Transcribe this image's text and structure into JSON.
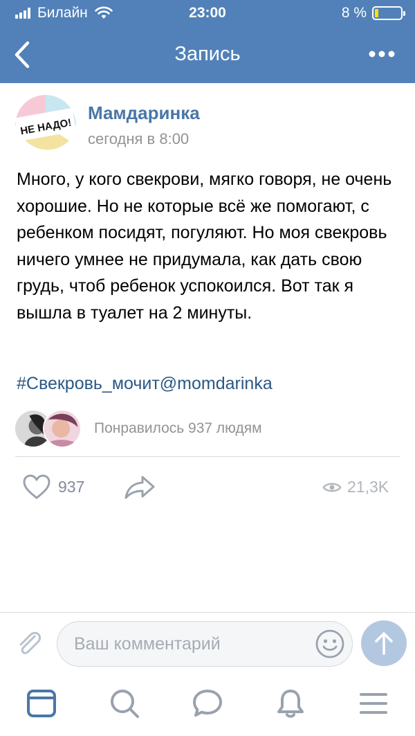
{
  "status_bar": {
    "carrier": "Билайн",
    "time": "23:00",
    "battery_percent": "8 %",
    "battery_level": 0.08
  },
  "nav": {
    "title": "Запись"
  },
  "post": {
    "author": "Мамдаринка",
    "timestamp": "сегодня в 8:00",
    "avatar_text": "НЕ НАДО!",
    "text": "Много, у кого свекрови, мягко говоря, не очень хорошие. Но не которые всё же помогают, с ребенком посидят, погуляют. Но моя свекровь ничего умнее не придумала, как дать свою грудь, чтоб ребенок успокоился. Вот так я вышла в туалет на 2 минуты.",
    "hashtag": "#Свекровь_мочит@momdarinka",
    "liked_by": "Понравилось 937 людям",
    "likes": "937",
    "views": "21,3K"
  },
  "comment": {
    "placeholder": "Ваш комментарий"
  },
  "colors": {
    "header": "#5181b8",
    "link": "#2a5885",
    "author": "#4a76a8",
    "tab_active": "#4a76a8",
    "tab_inactive": "#99a2ad"
  }
}
